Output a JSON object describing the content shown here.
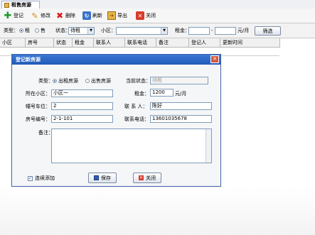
{
  "tab": {
    "label": "租售房源"
  },
  "toolbar": {
    "add": "登记",
    "edit": "修改",
    "delete": "删除",
    "refresh": "刷新",
    "export": "导出",
    "close": "关闭"
  },
  "filter": {
    "type_label": "类型：",
    "rent": "租",
    "sale": "售",
    "status_label": "状态：",
    "status_value": "待租",
    "community_label": "小区：",
    "community_value": "",
    "rent_label": "租金：",
    "rent_from": "",
    "dash": "-",
    "rent_to": "",
    "unit": "元/月",
    "filter_btn": "筛选"
  },
  "grid": {
    "columns": [
      "小区",
      "房号",
      "状态",
      "租金",
      "联系人",
      "联系电话",
      "备注",
      "登记人",
      "更新时间"
    ]
  },
  "dialog": {
    "title": "登记新房源",
    "type_label": "类型：",
    "rent_option": "出租房源",
    "sale_option": "出售房源",
    "status_label": "当前状态：",
    "status_value": "待租",
    "community_label": "所在小区：",
    "community_value": "小区一",
    "rent_label": "租金：",
    "rent_value": "1200",
    "rent_unit": "元/月",
    "building_label": "幢号车位：",
    "building_value": "2",
    "contact_label": "联 系 人：",
    "contact_value": "陈好",
    "room_label": "房号编号：",
    "room_value": "2-1-101",
    "phone_label": "联系电话：",
    "phone_value": "13601035678",
    "remark_label": "备注：",
    "remark_value": "",
    "continue_label": "连续添加",
    "save_btn": "保存",
    "close_btn": "关闭"
  },
  "colors": {
    "title_bar": "#225ab8",
    "accent": "#3e61a8"
  }
}
